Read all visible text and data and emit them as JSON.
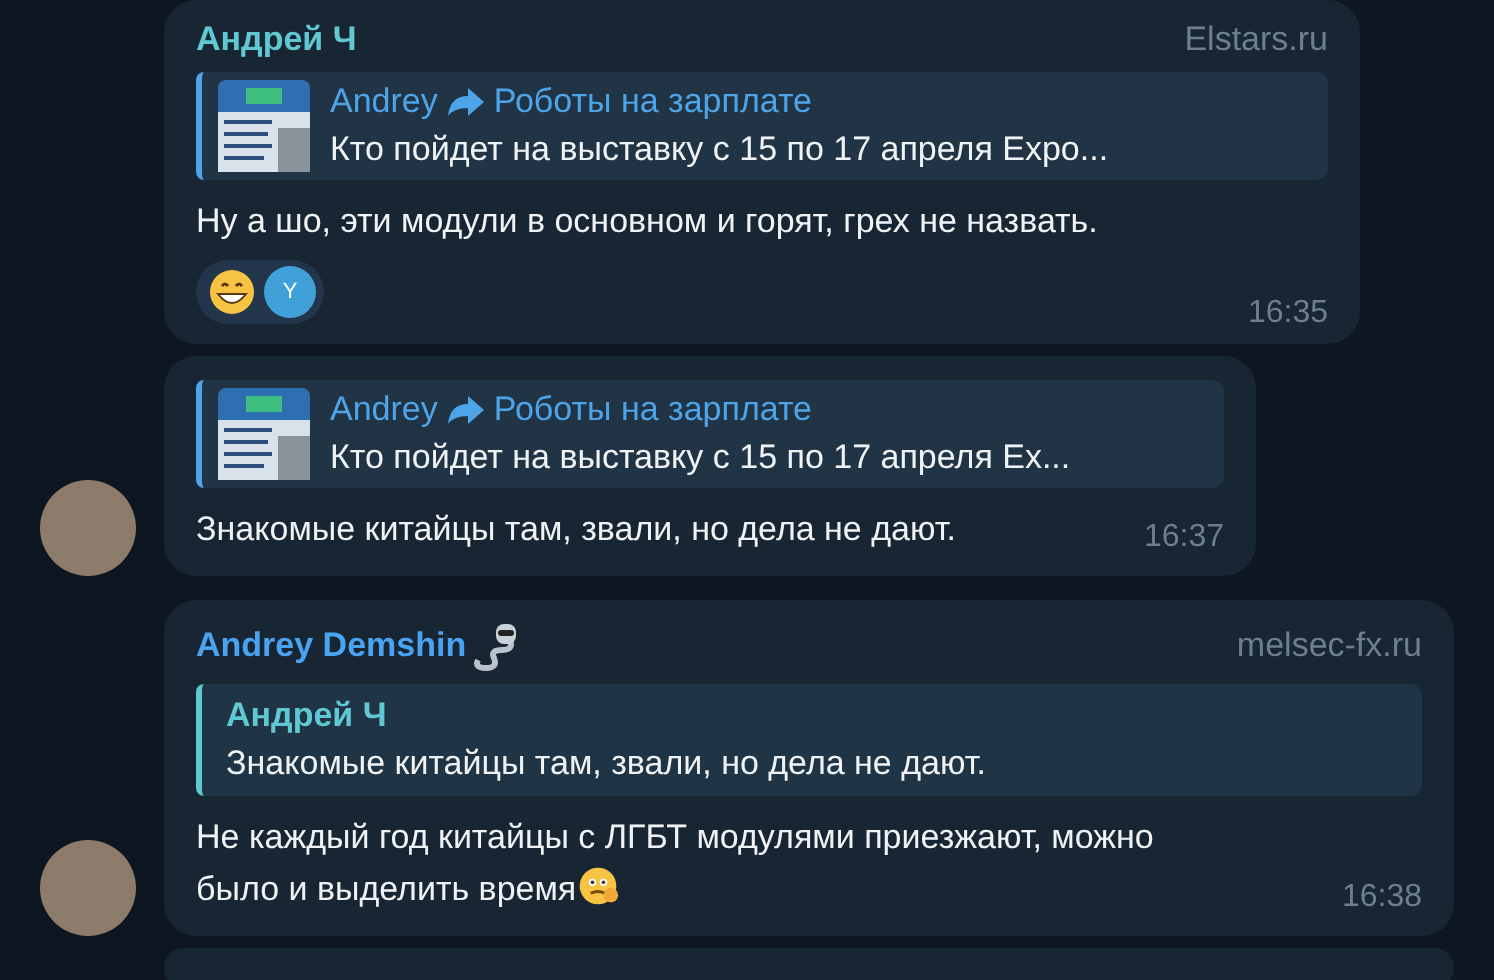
{
  "messages": [
    {
      "sender": "Андрей Ч",
      "color": "#5fc8d3",
      "site": "Elstars.ru",
      "avatar": false,
      "reply": {
        "kind": "forward",
        "author": "Andrey",
        "channel": "Роботы на зарплате",
        "text": "Кто пойдет на выставку с 15 по 17 апреля Expo..."
      },
      "text": "Ну а шо, эти модули в основном и горят, грех не назвать.",
      "reactions": [
        {
          "kind": "emoji"
        },
        {
          "kind": "user",
          "initial": "Y"
        }
      ],
      "time": "16:35"
    },
    {
      "avatar": true,
      "reply": {
        "kind": "forward",
        "author": "Andrey",
        "channel": "Роботы на зарплате",
        "text": "Кто пойдет на выставку с 15 по 17 апреля Ex..."
      },
      "text": "Знакомые китайцы там, звали, но дела не дают.",
      "time": "16:37"
    },
    {
      "sender": "Andrey Demshin",
      "color": "#4aa3f0",
      "site": "melsec-fx.ru",
      "avatar": true,
      "badge": true,
      "reply": {
        "kind": "quote",
        "author": "Андрей Ч",
        "text": "Знакомые китайцы там, звали, но дела не дают."
      },
      "text": "Не каждый год китайцы с ЛГБТ модулями приезжают, можно было и выделить время",
      "emoji": true,
      "time": "16:38"
    }
  ]
}
